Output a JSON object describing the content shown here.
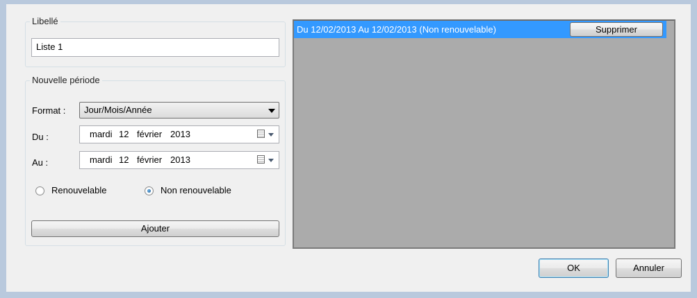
{
  "libelle": {
    "legend": "Libellé",
    "value": "Liste 1"
  },
  "nouvelle_periode": {
    "legend": "Nouvelle période",
    "format_label": "Format :",
    "format_value": "Jour/Mois/Année",
    "du_label": "Du :",
    "du_date": {
      "weekday": "mardi",
      "day": "12",
      "month": "février",
      "year": "2013"
    },
    "au_label": "Au :",
    "au_date": {
      "weekday": "mardi",
      "day": "12",
      "month": "février",
      "year": "2013"
    },
    "radio_renouvelable": "Renouvelable",
    "radio_non_renouvelable": "Non renouvelable",
    "selected_radio": "non_renouvelable",
    "add_button": "Ajouter"
  },
  "periods_list": {
    "items": [
      {
        "text": "Du 12/02/2013 Au 12/02/2013 (Non renouvelable)",
        "delete_label": "Supprimer"
      }
    ]
  },
  "footer": {
    "ok_label": "OK",
    "cancel_label": "Annuler"
  },
  "colors": {
    "selection": "#3399ff",
    "list_background": "#ababab",
    "dialog_background": "#f0f0f0"
  }
}
